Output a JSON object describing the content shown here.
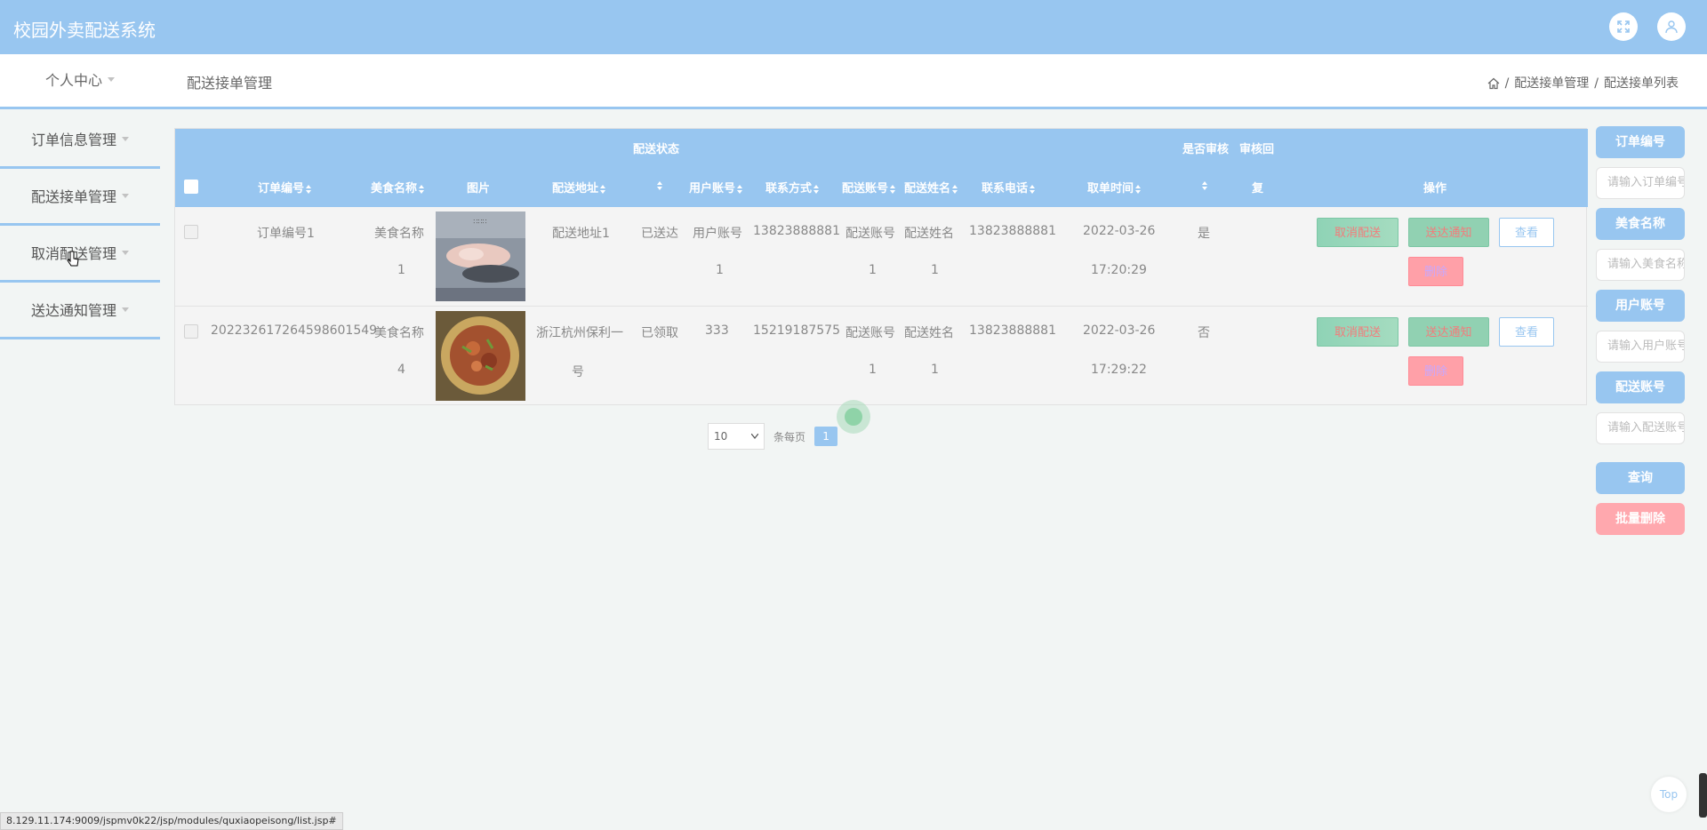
{
  "app": {
    "title": "校园外卖配送系统"
  },
  "header": {
    "fullscreen_icon": "expand-icon",
    "user_icon": "user-icon"
  },
  "subbar": {
    "personal_center": "个人中心",
    "page_title": "配送接单管理"
  },
  "breadcrumb": {
    "home_icon": "home-icon",
    "separator": "/",
    "level1": "配送接单管理",
    "level2": "配送接单列表"
  },
  "sidebar": {
    "items": [
      {
        "label": "订单信息管理"
      },
      {
        "label": "配送接单管理"
      },
      {
        "label": "取消配送管理"
      },
      {
        "label": "送达通知管理"
      }
    ]
  },
  "table": {
    "headers": {
      "delivery_status": "配送状态",
      "is_reviewed": "是否审核",
      "review_reply": "审核回",
      "order_no": "订单编号",
      "food_name": "美食名称",
      "image": "图片",
      "address": "配送地址",
      "user_account": "用户账号",
      "contact": "联系方式",
      "courier_account": "配送账号",
      "courier_name": "配送姓名",
      "phone": "联系电话",
      "pickup_time": "取单时间",
      "reply_tail": "复",
      "actions": "操作"
    },
    "rows": [
      {
        "order_no": "订单编号1",
        "food_line1": "美食名称",
        "food_line2": "1",
        "address_line1": "配送地址1",
        "address_line2": "",
        "status": "已送达",
        "user_line1": "用户账号",
        "user_line2": "1",
        "contact": "13823888881",
        "courier_line1": "配送账号",
        "courier_line2": "1",
        "name_line1": "配送姓名",
        "name_line2": "1",
        "phone": "13823888881",
        "time_line1": "2022-03-26",
        "time_line2": "17:20:29",
        "reviewed": "是"
      },
      {
        "order_no": "20223261726459860​1549",
        "food_line1": "美食名称",
        "food_line2": "4",
        "address_line1": "浙江杭州保利一",
        "address_line2": "号",
        "status": "已领取",
        "user_line1": "333",
        "user_line2": "",
        "contact": "15219187575",
        "courier_line1": "配送账号",
        "courier_line2": "1",
        "name_line1": "配送姓名",
        "name_line2": "1",
        "phone": "13823888881",
        "time_line1": "2022-03-26",
        "time_line2": "17:29:22",
        "reviewed": "否"
      }
    ],
    "actions": {
      "cancel": "取消配送",
      "notify": "送达通知",
      "view": "查看",
      "delete": "删除"
    }
  },
  "pager": {
    "page_size": "10",
    "per_page_label": "条每页",
    "current_page": "1"
  },
  "search_panel": {
    "order_no_label": "订单编号",
    "order_no_placeholder": "请输入订单编号",
    "food_label": "美食名称",
    "food_placeholder": "请输入美食名称",
    "user_label": "用户账号",
    "user_placeholder": "请输入用户账号",
    "courier_label": "配送账号",
    "courier_placeholder": "请输入配送账号",
    "search_button": "查询",
    "batch_delete_button": "批量删除"
  },
  "status_bar": {
    "url": "8.129.11.174:9009/jspmv0k22/jsp/modules/quxiaopeisong/list.jsp#"
  },
  "back_to_top": {
    "label": "Top"
  }
}
